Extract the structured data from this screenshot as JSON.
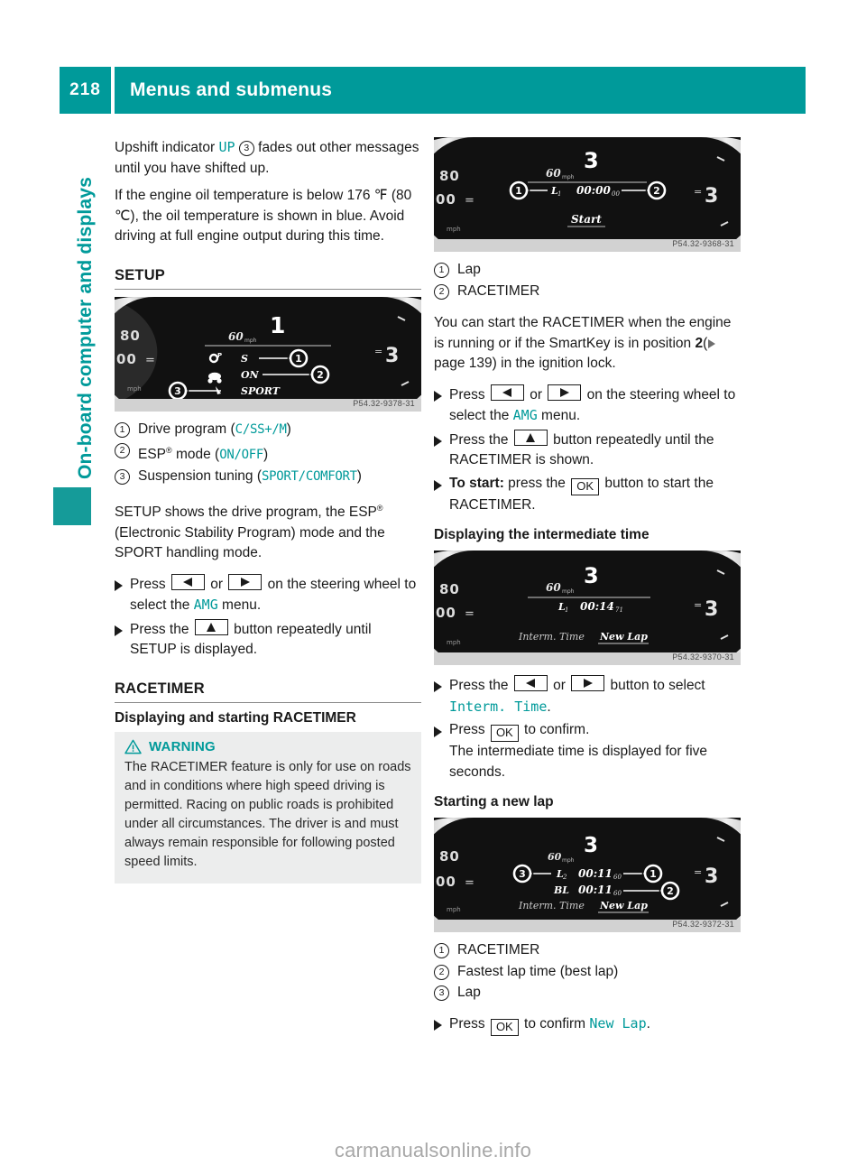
{
  "header": {
    "page_number": "218",
    "title": "Menus and submenus"
  },
  "side_tab": {
    "label": "On-board computer and displays"
  },
  "footer": {
    "watermark": "carmanualsonline.info"
  },
  "left_column": {
    "intro": {
      "para1_before": "Upshift indicator ",
      "para1_code": "UP",
      "para1_after": " fades out other messages until you have shifted up.",
      "para1_circle": "3",
      "para2": "If the engine oil temperature is below 176 ℉ (80 ℃), the oil temperature is shown in blue. Avoid driving at full engine output during this time."
    },
    "setup": {
      "heading": "SETUP",
      "figure_code": "P54.32-9378-31",
      "figure": {
        "gear": "1",
        "speed": "60",
        "speed_unit": "mph",
        "line1": "S",
        "line2": "ON",
        "line3": "SPORT",
        "callouts": [
          "1",
          "2",
          "3"
        ]
      },
      "legend": [
        {
          "num": "1",
          "text_before": "Drive program (",
          "codes": [
            "C",
            "SS+",
            "M"
          ],
          "text_after": ")"
        },
        {
          "num": "2",
          "text_before": "ESP® mode (",
          "codes": [
            "ON",
            "OFF"
          ],
          "text_after": ")"
        },
        {
          "num": "3",
          "text_before": "Suspension tuning (",
          "codes": [
            "SPORT",
            "COMFORT"
          ],
          "text_after": ")"
        }
      ],
      "description": "SETUP shows the drive program, the ESP® (Electronic Stability Program) mode and the SPORT handling mode.",
      "steps": [
        {
          "before": "Press ",
          "keys": [
            "left",
            "right"
          ],
          "mid": " or ",
          "after": " on the steering wheel to select the ",
          "code": "AMG",
          "tail": " menu."
        },
        {
          "before": "Press the ",
          "keys": [
            "up"
          ],
          "after": " button repeatedly until SETUP is displayed."
        }
      ]
    },
    "racetimer": {
      "heading": "RACETIMER",
      "subheading": "Displaying and starting RACETIMER",
      "warning": {
        "title": "WARNING",
        "icon": "warning-triangle-icon",
        "body": "The RACETIMER feature is only for use on roads and in conditions where high speed driving is permitted. Racing on public roads is prohibited under all circumstances. The driver is and must always remain responsible for following posted speed limits."
      }
    }
  },
  "right_column": {
    "fig_start": {
      "code": "P54.32-9368-31",
      "gear": "3",
      "speed": "60",
      "speed_unit": "mph",
      "lap_label": "L",
      "lap_index": "1",
      "time": "00:00",
      "time_frac": "00",
      "action": "Start",
      "callouts": [
        "1",
        "2"
      ]
    },
    "legend_start": [
      {
        "num": "1",
        "text": "Lap"
      },
      {
        "num": "2",
        "text": "RACETIMER"
      }
    ],
    "start_desc_before": "You can start the RACETIMER when the engine is running or if the SmartKey is in position ",
    "start_desc_bold": "2",
    "start_desc_ref": "page 139",
    "start_desc_after": " in the ignition lock.",
    "start_steps": [
      {
        "before": "Press ",
        "keys": [
          "left",
          "right"
        ],
        "mid": " or ",
        "after": " on the steering wheel to select the ",
        "code": "AMG",
        "tail": " menu."
      },
      {
        "before": "Press the ",
        "keys": [
          "up"
        ],
        "after": " button repeatedly until the RACETIMER is shown."
      },
      {
        "bold": "To start:",
        "before": " press the ",
        "ok": "OK",
        "after": " button to start the RACETIMER."
      }
    ],
    "intermediate": {
      "heading": "Displaying the intermediate time",
      "figure_code": "P54.32-9370-31",
      "figure": {
        "gear": "3",
        "speed": "60",
        "speed_unit": "mph",
        "lap_label": "L",
        "lap_index": "1",
        "time": "00:14",
        "time_frac": "71",
        "menu_left": "Interm. Time",
        "menu_right": "New Lap"
      },
      "steps": [
        {
          "before": "Press the ",
          "keys": [
            "left",
            "right"
          ],
          "mid": " or ",
          "after": " button to select ",
          "code": "Interm. Time",
          "tail": "."
        },
        {
          "before": "Press ",
          "ok": "OK",
          "after": " to confirm.",
          "sub": "The intermediate time is displayed for five seconds."
        }
      ]
    },
    "newlap": {
      "heading": "Starting a new lap",
      "figure_code": "P54.32-9372-31",
      "figure": {
        "gear": "3",
        "speed": "60",
        "speed_unit": "mph",
        "row1_label": "L",
        "row1_index": "2",
        "row1_time": "00:11",
        "row1_frac": "60",
        "row2_label": "BL",
        "row2_time": "00:11",
        "row2_frac": "60",
        "menu_left": "Interm. Time",
        "menu_right": "New Lap",
        "callouts": [
          "1",
          "2",
          "3"
        ]
      },
      "legend": [
        {
          "num": "1",
          "text": "RACETIMER"
        },
        {
          "num": "2",
          "text": "Fastest lap time (best lap)"
        },
        {
          "num": "3",
          "text": "Lap"
        }
      ],
      "step": {
        "before": "Press ",
        "ok": "OK",
        "after": " to confirm ",
        "code": "New Lap",
        "tail": "."
      }
    }
  },
  "colors": {
    "accent_teal": "#009a9a",
    "warning_bg": "#eceded",
    "rule": "#8c8c8c"
  }
}
